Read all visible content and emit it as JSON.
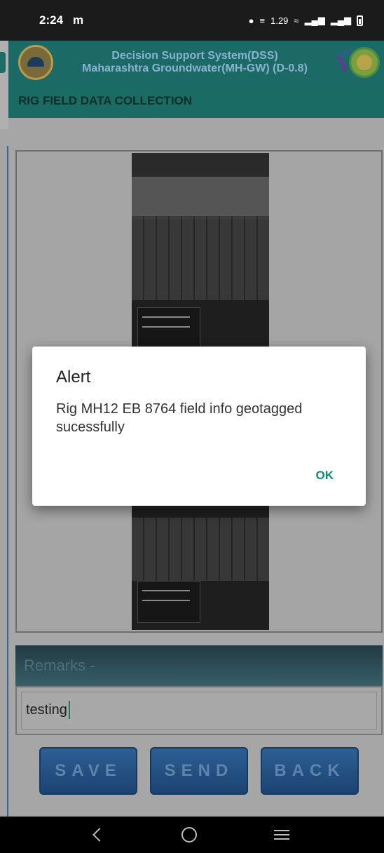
{
  "status_bar": {
    "time": "2:24",
    "notification_glyph": "m",
    "icons": [
      "location-icon",
      "volte-icon",
      "data-speed-icon",
      "wifi-icon",
      "signal-icon",
      "signal-icon",
      "battery-icon"
    ],
    "speed_text": "1.29"
  },
  "header": {
    "title_line1": "Decision Support System(DSS)",
    "title_line2": "Maharashtra Groundwater(MH-GW) (D-0.8)"
  },
  "subheader": {
    "title": "RIG FIELD DATA COLLECTION"
  },
  "remarks": {
    "label": "Remarks -",
    "value": "testing"
  },
  "buttons": {
    "save": "SAVE",
    "send": "SEND",
    "back": "BACK"
  },
  "dialog": {
    "title": "Alert",
    "message": "Rig MH12 EB 8764 field info geotagged sucessfully",
    "ok": "OK"
  },
  "colors": {
    "header_bg": "#1b6a65",
    "button_bg": "#2d5f95",
    "dialog_ok": "#0c8a78"
  }
}
